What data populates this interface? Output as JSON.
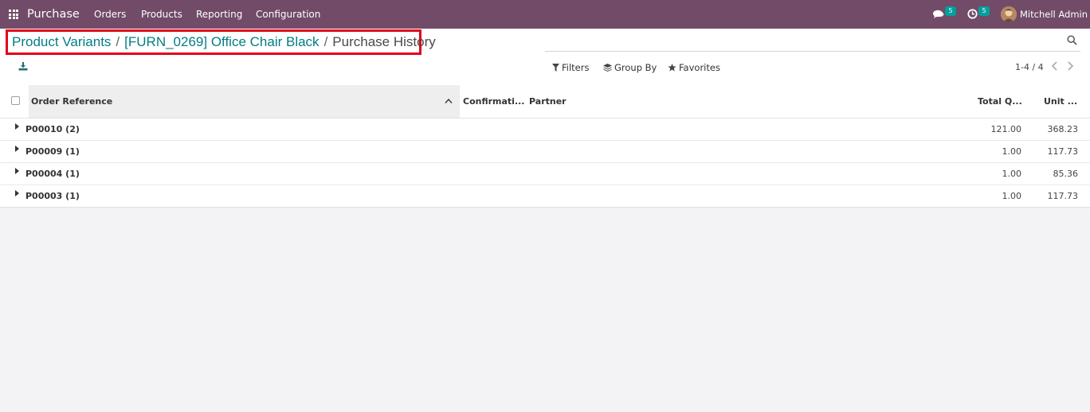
{
  "navbar": {
    "app_name": "Purchase",
    "menu": [
      "Orders",
      "Products",
      "Reporting",
      "Configuration"
    ],
    "messages_badge": "5",
    "activities_badge": "5",
    "user_name": "Mitchell Admin",
    "bg_color": "#714b67"
  },
  "breadcrumb": {
    "items": [
      "Product Variants",
      "[FURN_0269] Office Chair Black"
    ],
    "separator": "/",
    "current": "Purchase History",
    "highlight_color": "#e2001a"
  },
  "search": {
    "value": "",
    "placeholder": ""
  },
  "filters": {
    "filters_label": "Filters",
    "group_by_label": "Group By",
    "favorites_label": "Favorites"
  },
  "pager": {
    "text": "1-4 / 4"
  },
  "table": {
    "headers": {
      "order_reference": "Order Reference",
      "confirmation": "Confirmati...",
      "partner": "Partner",
      "total_qty": "Total Q...",
      "unit": "Unit ..."
    },
    "groups": [
      {
        "label": "P00010 (2)",
        "total_qty": "121.00",
        "unit": "368.23"
      },
      {
        "label": "P00009 (1)",
        "total_qty": "1.00",
        "unit": "117.73"
      },
      {
        "label": "P00004 (1)",
        "total_qty": "1.00",
        "unit": "85.36"
      },
      {
        "label": "P00003 (1)",
        "total_qty": "1.00",
        "unit": "117.73"
      }
    ]
  }
}
